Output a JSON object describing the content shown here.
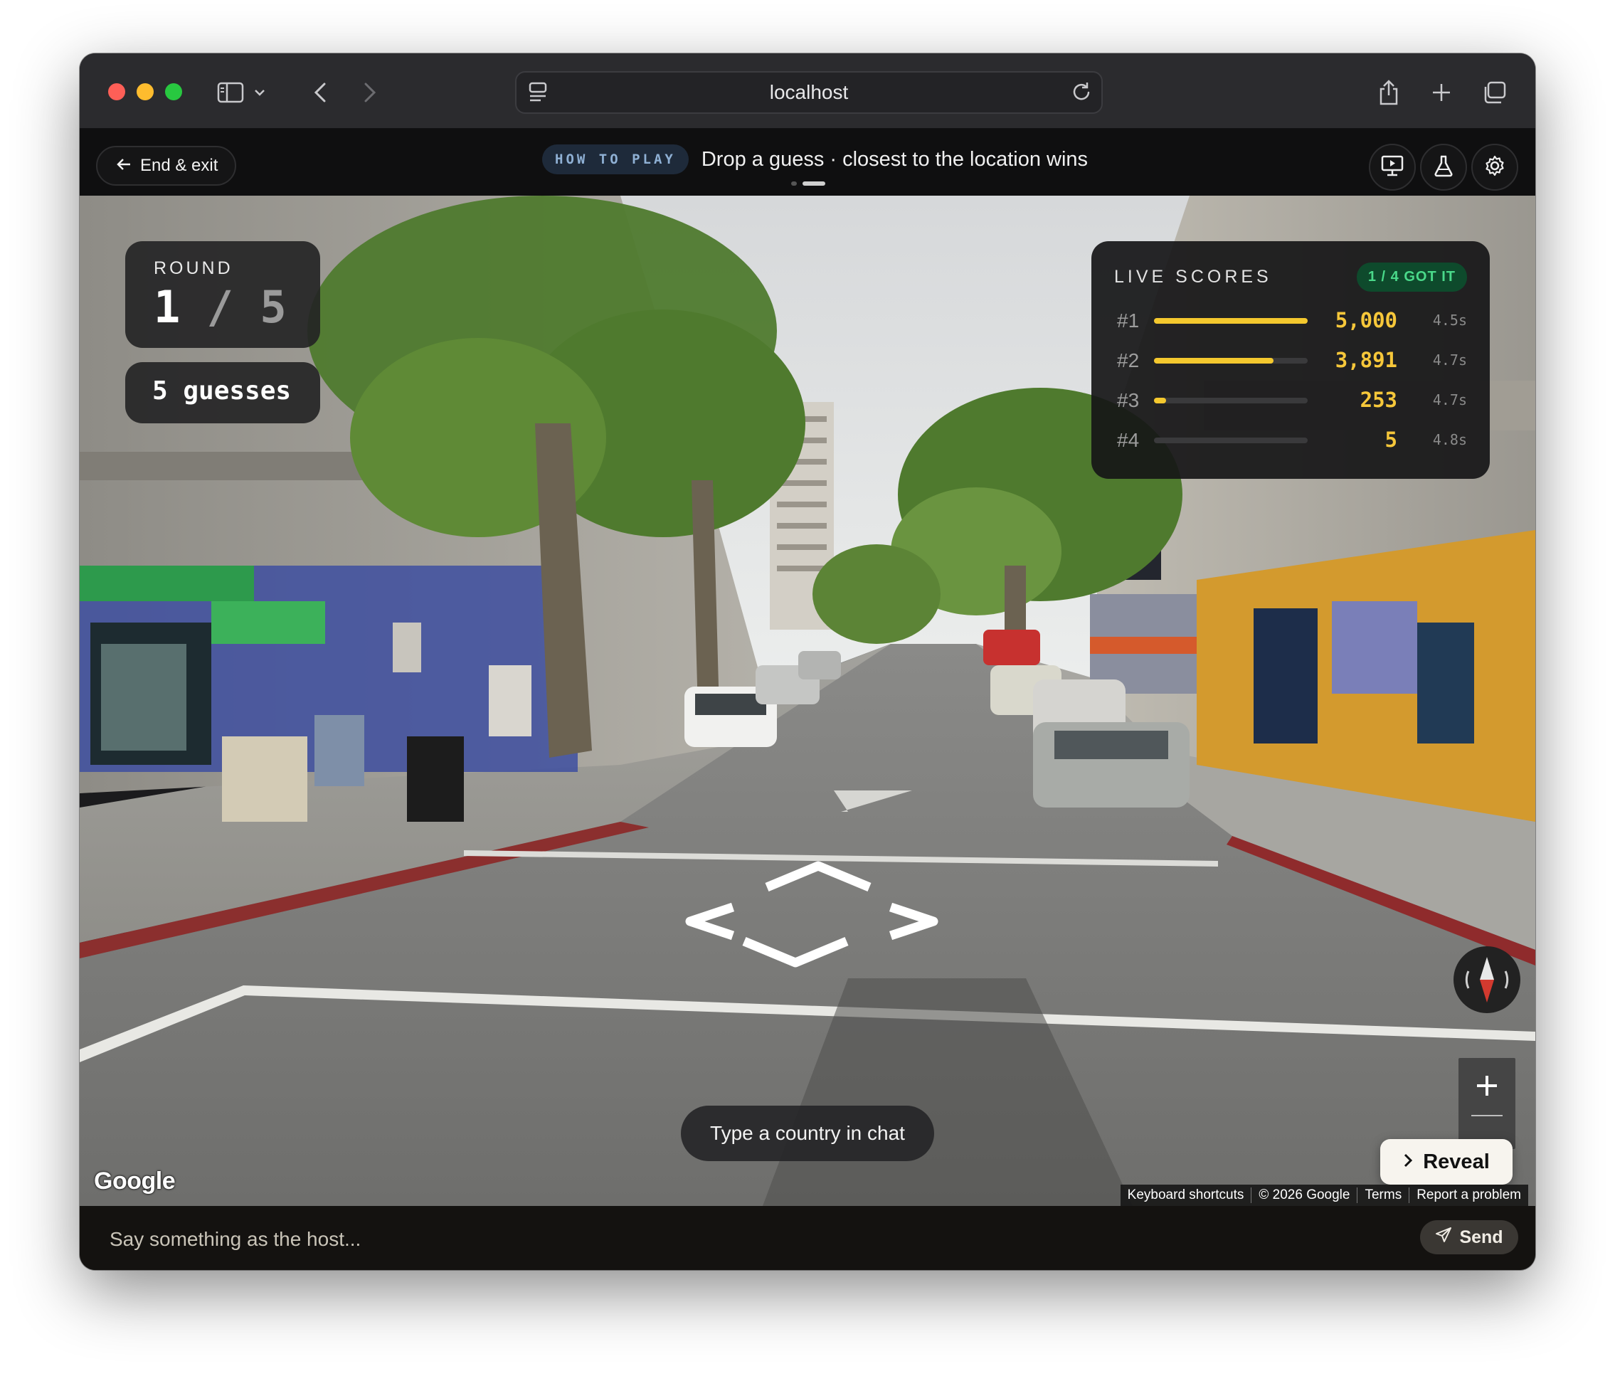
{
  "browser": {
    "url": "localhost"
  },
  "topbar": {
    "exit_label": "End & exit",
    "how_to_play_label": "HOW TO PLAY",
    "instruction": "Drop a guess · closest to the location wins"
  },
  "round": {
    "label": "ROUND",
    "current": "1",
    "separator": "/",
    "total": "5",
    "guesses": "5 guesses"
  },
  "live_scores": {
    "title": "LIVE SCORES",
    "badge": "1 / 4 GOT IT",
    "max_points": 5000,
    "rows": [
      {
        "rank": "#1",
        "points": "5,000",
        "value": 5000,
        "time": "4.5s"
      },
      {
        "rank": "#2",
        "points": "3,891",
        "value": 3891,
        "time": "4.7s"
      },
      {
        "rank": "#3",
        "points": "253",
        "value": 253,
        "time": "4.7s"
      },
      {
        "rank": "#4",
        "points": "5",
        "value": 5,
        "time": "4.8s"
      }
    ]
  },
  "map": {
    "hint": "Type a country in chat",
    "reveal_label": "Reveal",
    "logo": "Google",
    "attribution": [
      "Keyboard shortcuts",
      "© 2026 Google",
      "Terms",
      "Report a problem"
    ]
  },
  "chat": {
    "placeholder": "Say something as the host...",
    "send_label": "Send"
  },
  "colors": {
    "accent_gold": "#f4c82e",
    "badge_green": "#4ad98a",
    "how_to_play": "#8fb0d4"
  }
}
